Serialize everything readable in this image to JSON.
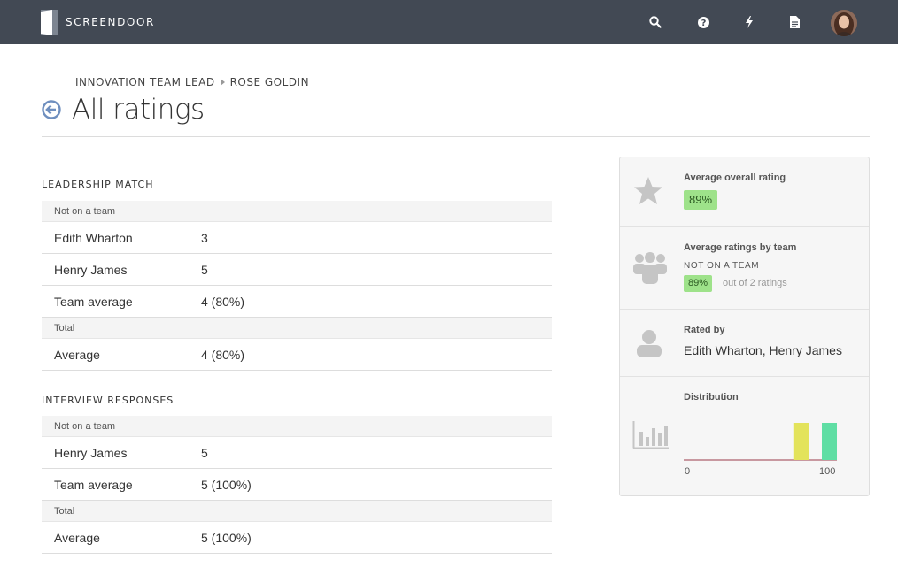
{
  "app": {
    "brand": "SCREENDOOR",
    "nav_icons": [
      "search-icon",
      "help-icon",
      "lightning-icon",
      "document-icon"
    ]
  },
  "header": {
    "breadcrumb": [
      "INNOVATION TEAM LEAD",
      "ROSE GOLDIN"
    ],
    "title": "All ratings"
  },
  "sections": [
    {
      "title": "LEADERSHIP MATCH",
      "team_label": "Not on a team",
      "rows": [
        {
          "name": "Edith Wharton",
          "value": "3"
        },
        {
          "name": "Henry James",
          "value": "5"
        },
        {
          "name": "Team average",
          "value": "4 (80%)"
        }
      ],
      "total_label": "Total",
      "total_row": {
        "name": "Average",
        "value": "4 (80%)"
      }
    },
    {
      "title": "INTERVIEW RESPONSES",
      "team_label": "Not on a team",
      "rows": [
        {
          "name": "Henry James",
          "value": "5"
        },
        {
          "name": "Team average",
          "value": "5 (100%)"
        }
      ],
      "total_label": "Total",
      "total_row": {
        "name": "Average",
        "value": "5 (100%)"
      }
    }
  ],
  "summary": {
    "overall_label": "Average overall rating",
    "overall_value": "89%",
    "by_team_label": "Average ratings by team",
    "team_name": "NOT ON A TEAM",
    "team_value": "89%",
    "team_count_text": "out of 2 ratings",
    "rated_by_label": "Rated by",
    "rated_by_names": "Edith Wharton, Henry James",
    "distribution_label": "Distribution"
  },
  "chart_data": {
    "type": "bar",
    "x_tick_labels": [
      "0",
      "100"
    ],
    "xlim": [
      0,
      100
    ],
    "bars": [
      {
        "x": 80,
        "value": 1,
        "color": "#e3e35b"
      },
      {
        "x": 100,
        "value": 1,
        "color": "#5fdea4"
      }
    ],
    "colors": {
      "baseline": "#9b3a4a"
    }
  },
  "colors": {
    "topbar": "#424954",
    "badge_bg": "#9ee28a",
    "card_bg": "#f6f6f6",
    "icon_gray": "#c5c5c5",
    "back_icon": "#6f8fbf"
  }
}
